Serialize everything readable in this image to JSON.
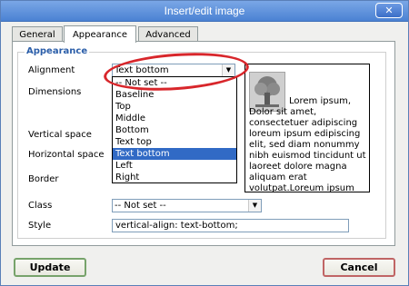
{
  "window": {
    "title": "Insert/edit image",
    "close_icon": "close-icon"
  },
  "tabs": [
    {
      "label": "General",
      "active": false
    },
    {
      "label": "Appearance",
      "active": true
    },
    {
      "label": "Advanced",
      "active": false
    }
  ],
  "appearance": {
    "legend": "Appearance",
    "labels": {
      "alignment": "Alignment",
      "dimensions": "Dimensions",
      "vertical_space": "Vertical space",
      "horizontal_space": "Horizontal space",
      "border": "Border",
      "class": "Class",
      "style": "Style"
    },
    "alignment_value": "Text bottom",
    "alignment_options": [
      "-- Not set --",
      "Baseline",
      "Top",
      "Middle",
      "Bottom",
      "Text top",
      "Text bottom",
      "Left",
      "Right"
    ],
    "class_value": "-- Not set --",
    "style_value": "vertical-align: text-bottom;",
    "preview_text": "Lorem ipsum, Dolor sit amet, consectetuer adipiscing loreum ipsum edipiscing elit, sed diam nonummy nibh euismod tincidunt ut laoreet dolore magna aliquam erat volutpat.Loreum ipsum"
  },
  "buttons": {
    "update": "Update",
    "cancel": "Cancel"
  },
  "colors": {
    "annotation": "#d8262b",
    "selection": "#316ac5",
    "legend": "#2b5ea9"
  }
}
